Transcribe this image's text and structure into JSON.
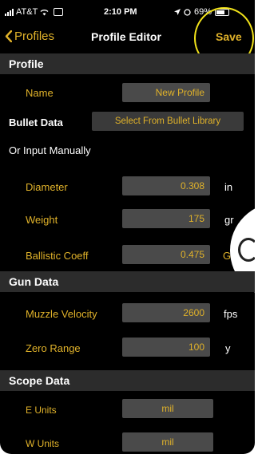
{
  "status_bar": {
    "carrier": "AT&T",
    "wifi_icon": "wifi-icon",
    "battery_small_text": "",
    "time": "2:10 PM",
    "battery_percent": "69%"
  },
  "nav": {
    "back_label": "Profiles",
    "title": "Profile Editor",
    "save_label": "Save"
  },
  "profile": {
    "header": "Profile",
    "name_label": "Name",
    "name_value": "New Profile"
  },
  "bullet_data": {
    "header": "Bullet Data",
    "library_button": "Select From Bullet Library",
    "manual_label": "Or Input Manually",
    "rows": [
      {
        "label": "Diameter",
        "value": "0.308",
        "unit": "in"
      },
      {
        "label": "Weight",
        "value": "175",
        "unit": "gr"
      },
      {
        "label": "Ballistic Coeff",
        "value": "0.475",
        "unit": "G"
      }
    ]
  },
  "gun_data": {
    "header": "Gun Data",
    "rows": [
      {
        "label": "Muzzle Velocity",
        "value": "2600",
        "unit": "fps"
      },
      {
        "label": "Zero Range",
        "value": "100",
        "unit": "y"
      }
    ]
  },
  "scope_data": {
    "header": "Scope Data",
    "rows": [
      {
        "label": "E Units",
        "value": "mil"
      },
      {
        "label": "W Units",
        "value": "mil"
      }
    ]
  },
  "colors": {
    "accent": "#e0b22a",
    "field_bg": "#4a4a4a",
    "header_bg": "#2c2c2c",
    "highlight": "#f1e21a"
  }
}
